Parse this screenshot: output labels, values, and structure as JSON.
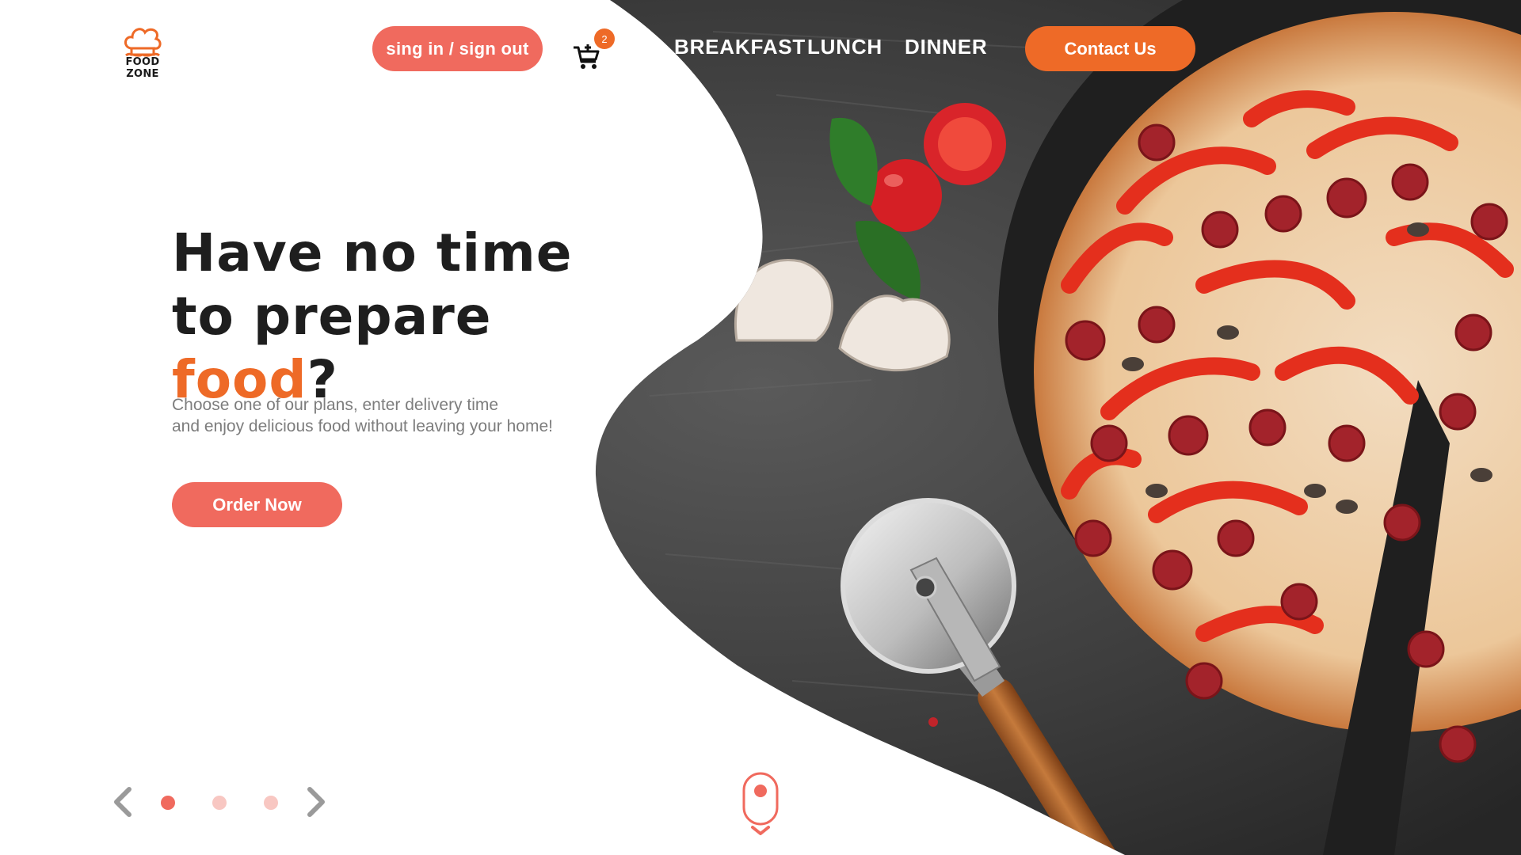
{
  "brand": {
    "name": "FOOD ZONE"
  },
  "header": {
    "signin_label": "sing in / sign out",
    "cart_count": "2",
    "nav": [
      {
        "label": "BREAKFAST"
      },
      {
        "label": "LUNCH"
      },
      {
        "label": "DINNER"
      }
    ],
    "contact_label": "Contact Us"
  },
  "hero": {
    "title_line1": "Have no time",
    "title_line2_prefix": "to prepare ",
    "title_accent": "food",
    "title_suffix": "?",
    "subtitle_line1": "Choose one of our plans, enter delivery time",
    "subtitle_line2": "and enjoy delicious food without leaving your home!",
    "order_label": "Order Now"
  },
  "slider": {
    "slides": 3,
    "active_index": 0
  },
  "colors": {
    "accent_orange": "#ee6a27",
    "button_coral": "#f06a5e",
    "dot_inactive": "#f8c7c2",
    "slate": "#3a3a3a"
  },
  "icons": [
    "chef-hat-icon",
    "cart-add-icon",
    "chevron-left-icon",
    "chevron-right-icon",
    "scroll-mouse-icon",
    "chevron-down-icon"
  ]
}
